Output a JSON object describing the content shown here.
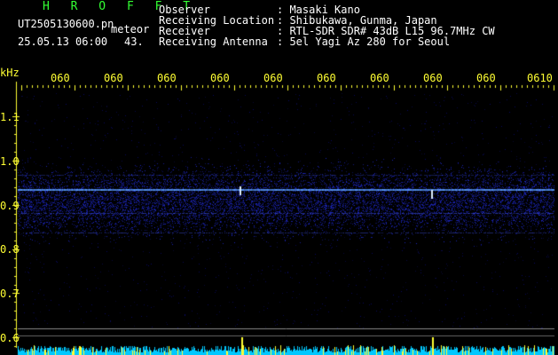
{
  "header": {
    "logo": "H R O F F T",
    "filename": "UT2505130600.pn",
    "meteor_label": "meteor",
    "datetime": "25.05.13 06:00",
    "meteor_count": "43.",
    "fields": [
      {
        "label": "Observer",
        "value": ": Masaki Kano"
      },
      {
        "label": "Receiving Location",
        "value": ": Shibukawa, Gunma, Japan"
      },
      {
        "label": "Receiver",
        "value": ": RTL-SDR SDR# 43dB L15 96.7MHz CW"
      },
      {
        "label": "Receiving Antenna",
        "value": ": 5el Yagi Az 280 for Seoul"
      }
    ]
  },
  "axis": {
    "unit": "kHz",
    "y_ticks": [
      "1.1",
      "1.0",
      "0.9",
      "0.8",
      "0.7",
      "0.6"
    ],
    "time_ticks": [
      "060",
      "060",
      "060",
      "060",
      "060",
      "060",
      "060",
      "060",
      "060",
      "0610"
    ]
  },
  "colors": {
    "background": "#000000",
    "signal": "#3344ff",
    "carrier": "#66aaff",
    "axis_text": "#ffff33",
    "header_text": "#ffffff",
    "logo": "#33ff33",
    "level_bars": "#00ccff"
  }
}
